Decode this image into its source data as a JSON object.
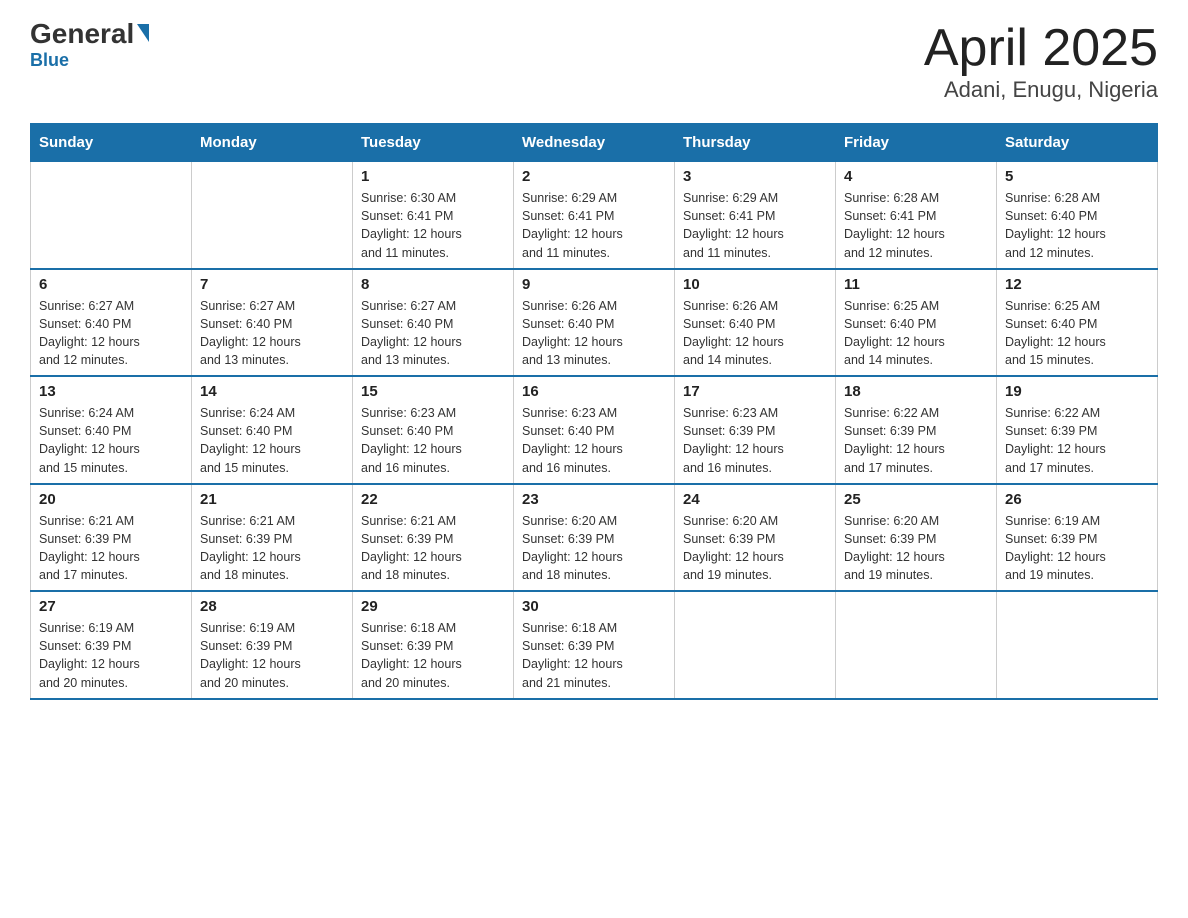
{
  "header": {
    "logo_main": "General",
    "logo_sub": "Blue",
    "title": "April 2025",
    "subtitle": "Adani, Enugu, Nigeria"
  },
  "days_of_week": [
    "Sunday",
    "Monday",
    "Tuesday",
    "Wednesday",
    "Thursday",
    "Friday",
    "Saturday"
  ],
  "weeks": [
    [
      {
        "day": "",
        "info": ""
      },
      {
        "day": "",
        "info": ""
      },
      {
        "day": "1",
        "info": "Sunrise: 6:30 AM\nSunset: 6:41 PM\nDaylight: 12 hours\nand 11 minutes."
      },
      {
        "day": "2",
        "info": "Sunrise: 6:29 AM\nSunset: 6:41 PM\nDaylight: 12 hours\nand 11 minutes."
      },
      {
        "day": "3",
        "info": "Sunrise: 6:29 AM\nSunset: 6:41 PM\nDaylight: 12 hours\nand 11 minutes."
      },
      {
        "day": "4",
        "info": "Sunrise: 6:28 AM\nSunset: 6:41 PM\nDaylight: 12 hours\nand 12 minutes."
      },
      {
        "day": "5",
        "info": "Sunrise: 6:28 AM\nSunset: 6:40 PM\nDaylight: 12 hours\nand 12 minutes."
      }
    ],
    [
      {
        "day": "6",
        "info": "Sunrise: 6:27 AM\nSunset: 6:40 PM\nDaylight: 12 hours\nand 12 minutes."
      },
      {
        "day": "7",
        "info": "Sunrise: 6:27 AM\nSunset: 6:40 PM\nDaylight: 12 hours\nand 13 minutes."
      },
      {
        "day": "8",
        "info": "Sunrise: 6:27 AM\nSunset: 6:40 PM\nDaylight: 12 hours\nand 13 minutes."
      },
      {
        "day": "9",
        "info": "Sunrise: 6:26 AM\nSunset: 6:40 PM\nDaylight: 12 hours\nand 13 minutes."
      },
      {
        "day": "10",
        "info": "Sunrise: 6:26 AM\nSunset: 6:40 PM\nDaylight: 12 hours\nand 14 minutes."
      },
      {
        "day": "11",
        "info": "Sunrise: 6:25 AM\nSunset: 6:40 PM\nDaylight: 12 hours\nand 14 minutes."
      },
      {
        "day": "12",
        "info": "Sunrise: 6:25 AM\nSunset: 6:40 PM\nDaylight: 12 hours\nand 15 minutes."
      }
    ],
    [
      {
        "day": "13",
        "info": "Sunrise: 6:24 AM\nSunset: 6:40 PM\nDaylight: 12 hours\nand 15 minutes."
      },
      {
        "day": "14",
        "info": "Sunrise: 6:24 AM\nSunset: 6:40 PM\nDaylight: 12 hours\nand 15 minutes."
      },
      {
        "day": "15",
        "info": "Sunrise: 6:23 AM\nSunset: 6:40 PM\nDaylight: 12 hours\nand 16 minutes."
      },
      {
        "day": "16",
        "info": "Sunrise: 6:23 AM\nSunset: 6:40 PM\nDaylight: 12 hours\nand 16 minutes."
      },
      {
        "day": "17",
        "info": "Sunrise: 6:23 AM\nSunset: 6:39 PM\nDaylight: 12 hours\nand 16 minutes."
      },
      {
        "day": "18",
        "info": "Sunrise: 6:22 AM\nSunset: 6:39 PM\nDaylight: 12 hours\nand 17 minutes."
      },
      {
        "day": "19",
        "info": "Sunrise: 6:22 AM\nSunset: 6:39 PM\nDaylight: 12 hours\nand 17 minutes."
      }
    ],
    [
      {
        "day": "20",
        "info": "Sunrise: 6:21 AM\nSunset: 6:39 PM\nDaylight: 12 hours\nand 17 minutes."
      },
      {
        "day": "21",
        "info": "Sunrise: 6:21 AM\nSunset: 6:39 PM\nDaylight: 12 hours\nand 18 minutes."
      },
      {
        "day": "22",
        "info": "Sunrise: 6:21 AM\nSunset: 6:39 PM\nDaylight: 12 hours\nand 18 minutes."
      },
      {
        "day": "23",
        "info": "Sunrise: 6:20 AM\nSunset: 6:39 PM\nDaylight: 12 hours\nand 18 minutes."
      },
      {
        "day": "24",
        "info": "Sunrise: 6:20 AM\nSunset: 6:39 PM\nDaylight: 12 hours\nand 19 minutes."
      },
      {
        "day": "25",
        "info": "Sunrise: 6:20 AM\nSunset: 6:39 PM\nDaylight: 12 hours\nand 19 minutes."
      },
      {
        "day": "26",
        "info": "Sunrise: 6:19 AM\nSunset: 6:39 PM\nDaylight: 12 hours\nand 19 minutes."
      }
    ],
    [
      {
        "day": "27",
        "info": "Sunrise: 6:19 AM\nSunset: 6:39 PM\nDaylight: 12 hours\nand 20 minutes."
      },
      {
        "day": "28",
        "info": "Sunrise: 6:19 AM\nSunset: 6:39 PM\nDaylight: 12 hours\nand 20 minutes."
      },
      {
        "day": "29",
        "info": "Sunrise: 6:18 AM\nSunset: 6:39 PM\nDaylight: 12 hours\nand 20 minutes."
      },
      {
        "day": "30",
        "info": "Sunrise: 6:18 AM\nSunset: 6:39 PM\nDaylight: 12 hours\nand 21 minutes."
      },
      {
        "day": "",
        "info": ""
      },
      {
        "day": "",
        "info": ""
      },
      {
        "day": "",
        "info": ""
      }
    ]
  ]
}
